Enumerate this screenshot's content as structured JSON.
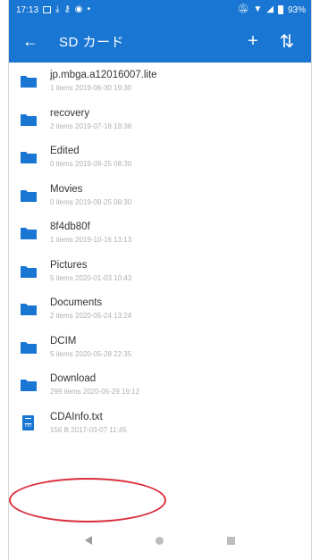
{
  "status_bar": {
    "time": "17:13",
    "left_icons": [
      "image-icon",
      "download-icon",
      "key-icon",
      "circle-icon",
      "dot-icon"
    ],
    "right_icons": [
      "mute-icon",
      "wifi-icon",
      "signal-icon",
      "battery-icon"
    ],
    "battery": "93%"
  },
  "app_bar": {
    "title": "SD カード",
    "back_icon": "←",
    "add_icon": "+",
    "sort_icon": "⇅"
  },
  "files": [
    {
      "name": "jp.mbga.a12016007.lite",
      "meta": "1 items 2019-06-30 19:30",
      "type": "folder"
    },
    {
      "name": "recovery",
      "meta": "2 items 2019-07-18 19:38",
      "type": "folder"
    },
    {
      "name": "Edited",
      "meta": "0 items 2019-09-25 08:30",
      "type": "folder"
    },
    {
      "name": "Movies",
      "meta": "0 items 2019-09-25 08:30",
      "type": "folder"
    },
    {
      "name": "8f4db80f",
      "meta": "1 items 2019-10-16 13:13",
      "type": "folder"
    },
    {
      "name": "Pictures",
      "meta": "5 items 2020-01-03 10:43",
      "type": "folder"
    },
    {
      "name": "Documents",
      "meta": "2 items 2020-05-24 13:24",
      "type": "folder"
    },
    {
      "name": "DCIM",
      "meta": "5 items 2020-05-28 22:35",
      "type": "folder"
    },
    {
      "name": "Download",
      "meta": "299 items 2020-05-29 19:12",
      "type": "folder"
    },
    {
      "name": "CDAInfo.txt",
      "meta": "156 B 2017-03-07 11:45",
      "type": "txt",
      "icon_label": "TXT"
    }
  ],
  "colors": {
    "accent": "#1976d2",
    "highlight": "#d92d3a"
  }
}
